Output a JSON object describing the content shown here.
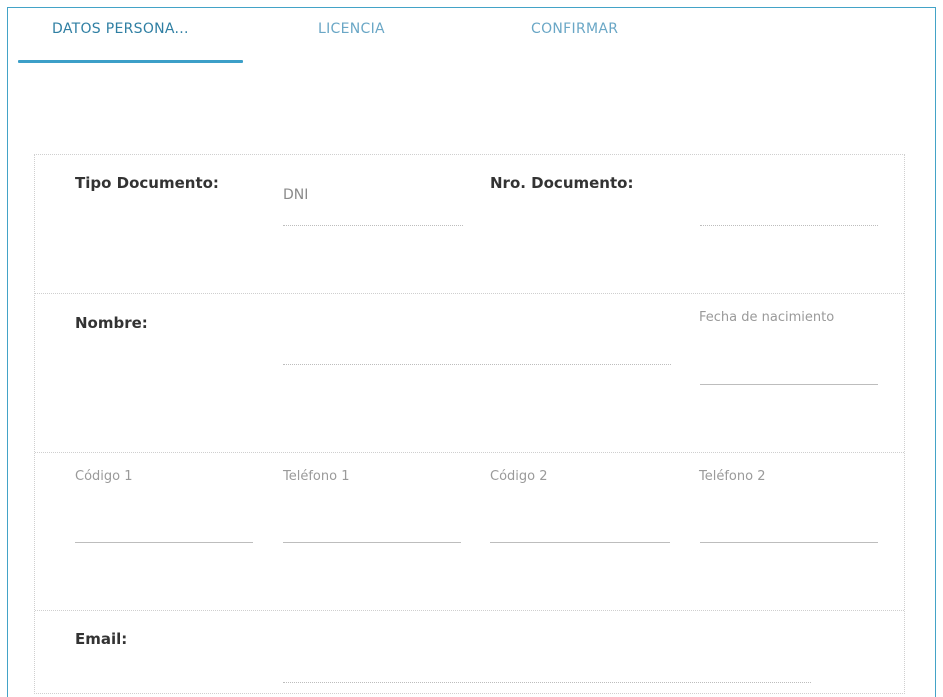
{
  "tabs": [
    {
      "label": "DATOS PERSONA..."
    },
    {
      "label": "LICENCIA"
    },
    {
      "label": "CONFIRMAR"
    }
  ],
  "form": {
    "tipo_documento": {
      "label": "Tipo Documento:",
      "value": "DNI"
    },
    "nro_documento": {
      "label": "Nro. Documento:",
      "value": ""
    },
    "nombre": {
      "label": "Nombre:",
      "value": ""
    },
    "fecha_nacimiento": {
      "label": "Fecha de nacimiento",
      "value": ""
    },
    "codigo1": {
      "label": "Código 1",
      "value": ""
    },
    "telefono1": {
      "label": "Teléfono 1",
      "value": ""
    },
    "codigo2": {
      "label": "Código 2",
      "value": ""
    },
    "telefono2": {
      "label": "Teléfono 2",
      "value": ""
    },
    "email": {
      "label": "Email:",
      "value": ""
    }
  },
  "colors": {
    "accent": "#3c9fc8",
    "tab_active": "#2f7fa3",
    "tab_inactive": "#6aa7c6",
    "label_text": "#333333",
    "muted_text": "#9a9a9a"
  }
}
